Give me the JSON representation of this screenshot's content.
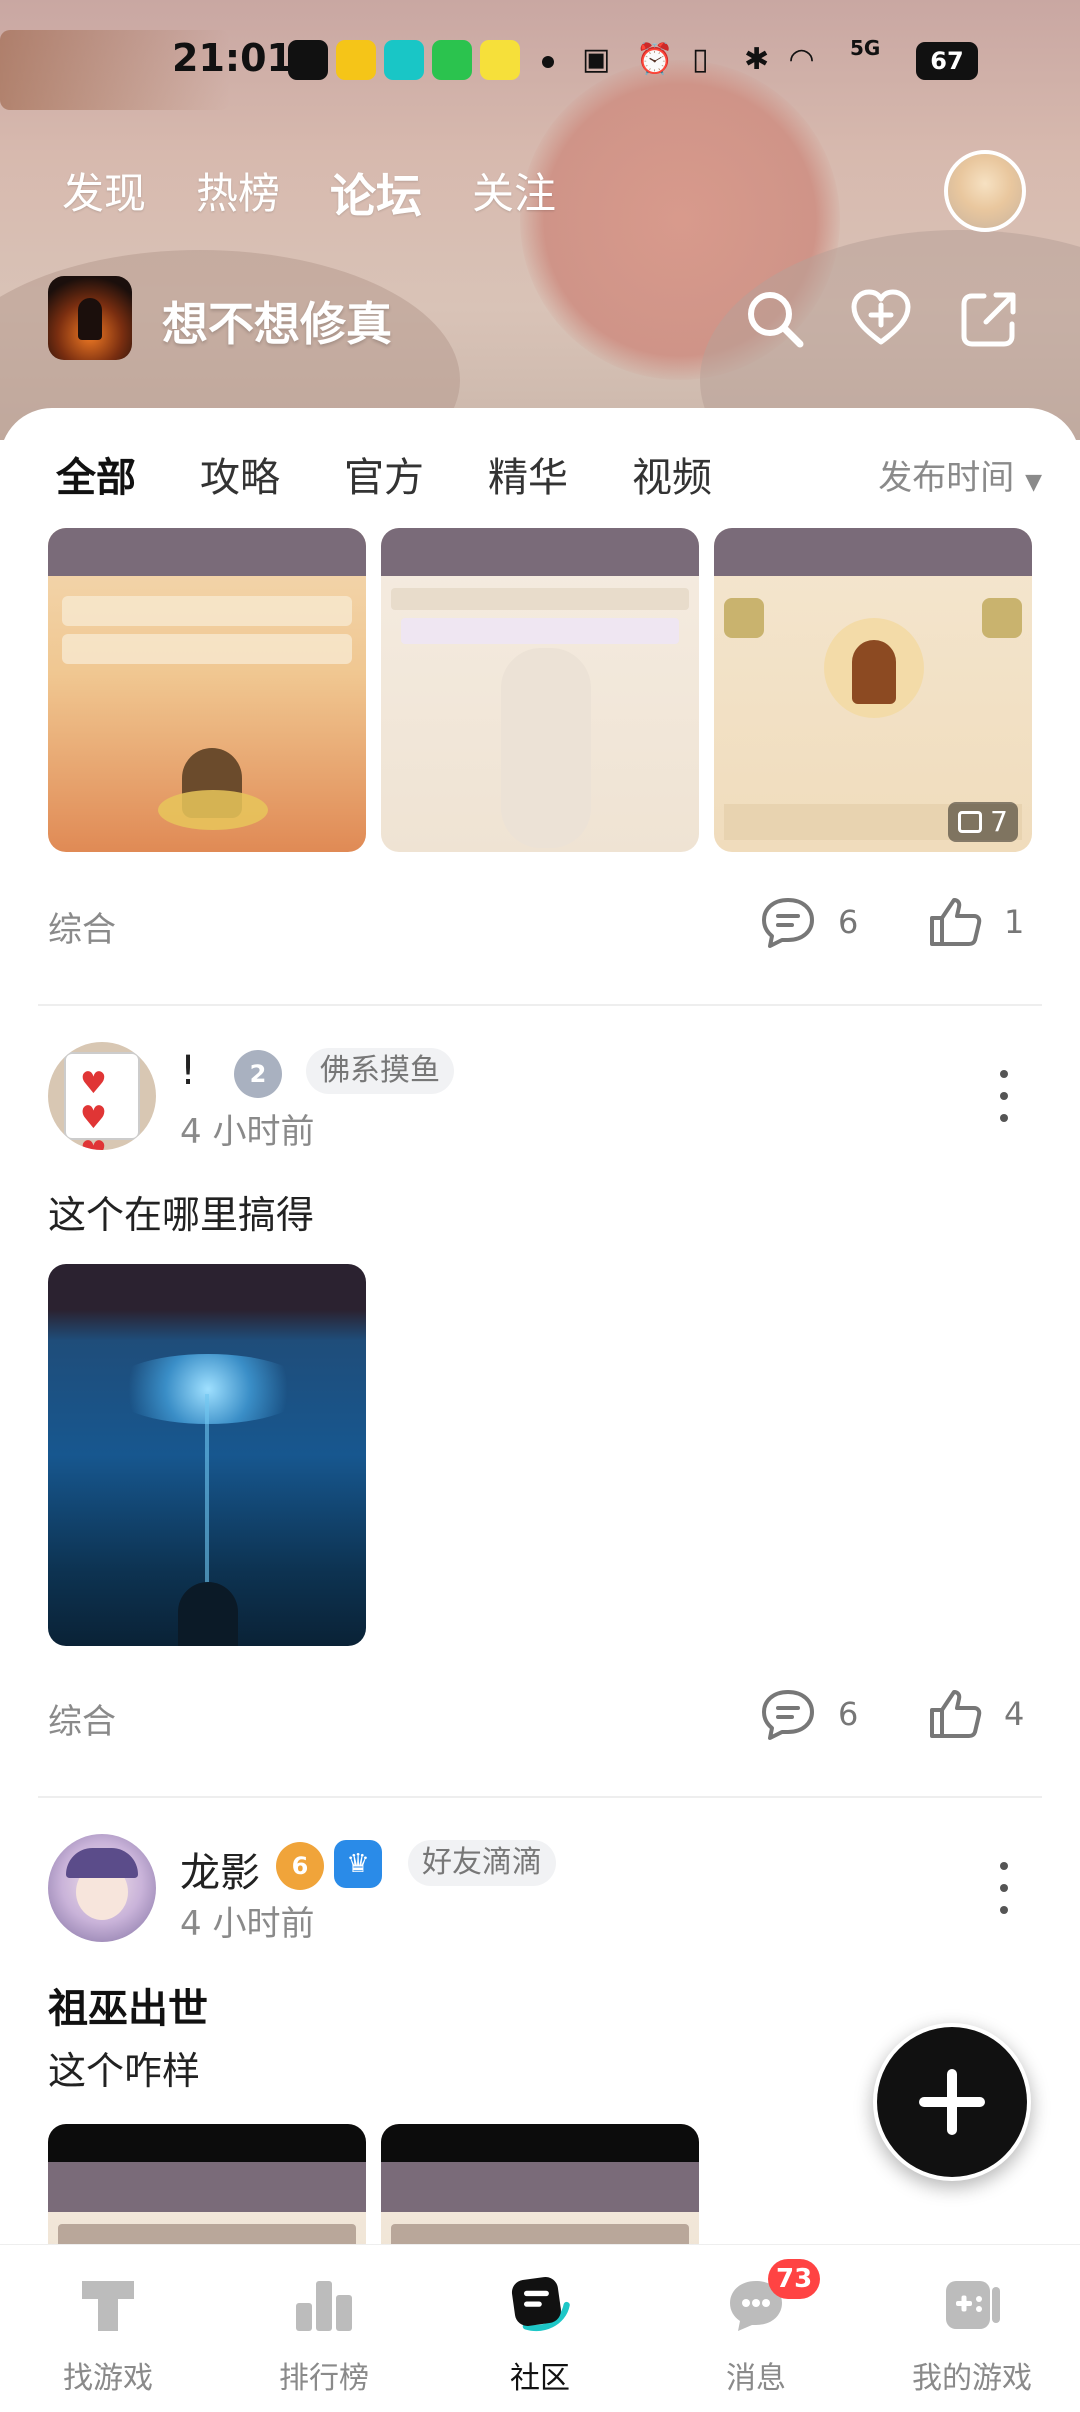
{
  "status_bar": {
    "time": "21:01",
    "network": "5G",
    "battery": "67"
  },
  "top_tabs": [
    {
      "label": "发现"
    },
    {
      "label": "热榜"
    },
    {
      "label": "论坛"
    },
    {
      "label": "关注"
    }
  ],
  "forum": {
    "name": "想不想修真"
  },
  "sub_tabs": [
    {
      "label": "全部"
    },
    {
      "label": "攻略"
    },
    {
      "label": "官方"
    },
    {
      "label": "精华"
    },
    {
      "label": "视频"
    }
  ],
  "sort_label": "发布时间",
  "posts": [
    {
      "image_count": "7",
      "category": "综合",
      "comments": "6",
      "likes": "1"
    },
    {
      "username": "!",
      "level": "2",
      "tag": "佛系摸鱼",
      "time": "4 小时前",
      "text": "这个在哪里搞得",
      "category": "综合",
      "comments": "6",
      "likes": "4"
    },
    {
      "username": "龙影",
      "level": "6",
      "tag": "好友滴滴",
      "time": "4 小时前",
      "title": "祖巫出世",
      "text": "这个咋样"
    }
  ],
  "bottom_nav": [
    {
      "label": "找游戏",
      "icon": "find-game-icon"
    },
    {
      "label": "排行榜",
      "icon": "ranking-icon"
    },
    {
      "label": "社区",
      "icon": "community-icon"
    },
    {
      "label": "消息",
      "icon": "message-icon",
      "badge": "73"
    },
    {
      "label": "我的游戏",
      "icon": "my-games-icon"
    }
  ],
  "colors": {
    "accent": "#1ec7c7",
    "badge_red": "#ff4343"
  }
}
